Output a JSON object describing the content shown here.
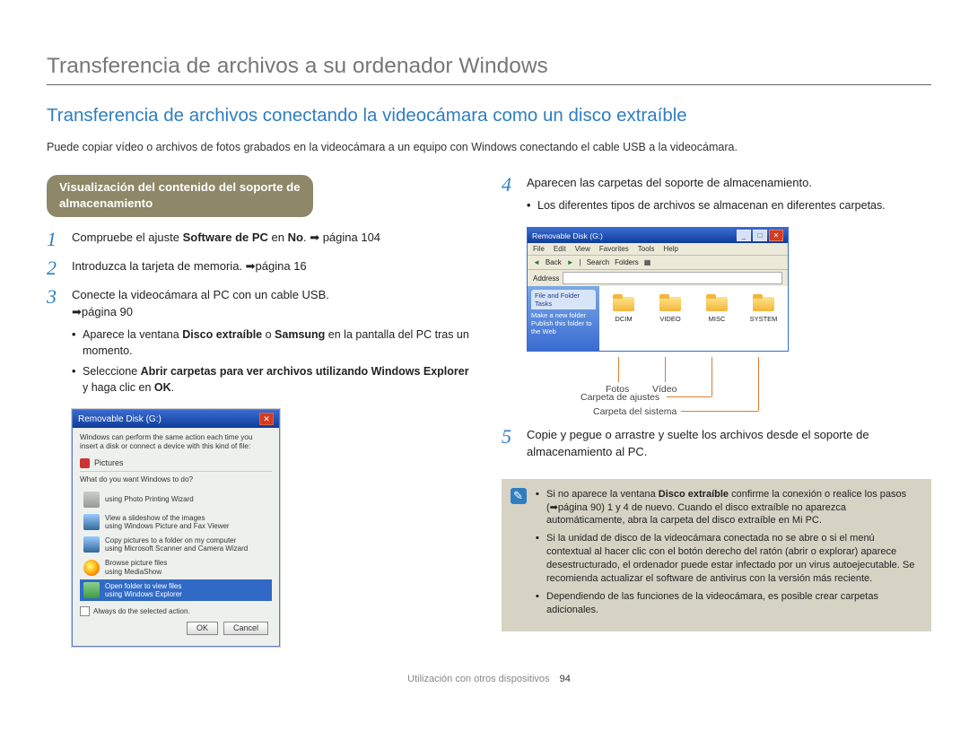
{
  "header": {
    "title": "Transferencia de archivos a su ordenador Windows",
    "section_title": "Transferencia de archivos conectando la videocámara como un disco extraíble",
    "intro": "Puede copiar vídeo o archivos de fotos grabados en la videocámara a un equipo con Windows conectando el cable USB a la videocámara."
  },
  "pill": {
    "line1": "Visualización del contenido del soporte de",
    "line2": "almacenamiento"
  },
  "steps": {
    "s1": {
      "num": "1",
      "text_pre": "Compruebe el ajuste ",
      "bold1": "Software de PC",
      "text_mid": " en ",
      "bold2": "No",
      "text_post": ". ➡ página 104"
    },
    "s2": {
      "num": "2",
      "text": "Introduzca la tarjeta de memoria. ➡página 16"
    },
    "s3": {
      "num": "3",
      "text": "Conecte la videocámara al PC con un cable USB.",
      "cont": "➡página 90",
      "b1_pre": "Aparece la ventana ",
      "b1_bold1": "Disco extraíble",
      "b1_mid": " o ",
      "b1_bold2": "Samsung",
      "b1_post": " en la pantalla del PC tras un momento.",
      "b2_pre": "Seleccione ",
      "b2_bold": "Abrir carpetas para ver archivos utilizando Windows Explorer",
      "b2_post": " y haga clic en ",
      "b2_bold2": "OK",
      "b2_end": "."
    },
    "s4": {
      "num": "4",
      "text": "Aparecen las carpetas del soporte de almacenamiento.",
      "bullet": "Los diferentes tipos de archivos se almacenan en diferentes carpetas."
    },
    "s5": {
      "num": "5",
      "text": "Copie y pegue o arrastre y suelte los archivos desde el soporte de almacenamiento al PC."
    }
  },
  "autoplay": {
    "title": "Removable Disk (G:)",
    "body_text": "Windows can perform the same action each time you insert a disk or connect a device with this kind of file:",
    "pictures": "Pictures",
    "prompt": "What do you want Windows to do?",
    "opts": {
      "o1a": "using Photo Printing Wizard",
      "o2a": "View a slideshow of the images",
      "o2b": "using Windows Picture and Fax Viewer",
      "o3a": "Copy pictures to a folder on my computer",
      "o3b": "using Microsoft Scanner and Camera Wizard",
      "o4a": "Browse picture files",
      "o4b": "using MediaShow",
      "o5a": "Open folder to view files",
      "o5b": "using Windows Explorer"
    },
    "check": "Always do the selected action.",
    "ok": "OK",
    "cancel": "Cancel"
  },
  "explorer": {
    "title": "Removable Disk (G:)",
    "menu": {
      "file": "File",
      "edit": "Edit",
      "view": "View",
      "fav": "Favorites",
      "tools": "Tools",
      "help": "Help"
    },
    "tb": {
      "back": "Back",
      "search": "Search",
      "folders": "Folders"
    },
    "addr": "Address",
    "task": "File and Folder Tasks",
    "side1": "Make a new folder",
    "side2": "Publish this folder to the Web",
    "folders": {
      "f1": "DCIM",
      "f2": "VIDEO",
      "f3": "MISC",
      "f4": "SYSTEM"
    }
  },
  "callouts": {
    "fotos": "Fotos",
    "video": "Vídeo",
    "ajustes": "Carpeta de ajustes",
    "sistema": "Carpeta del sistema"
  },
  "notes": {
    "n1_pre": "Si no aparece la ventana ",
    "n1_bold": "Disco extraíble",
    "n1_post": " confirme la conexión o realice los pasos (➡página 90) 1 y 4 de nuevo. Cuando el disco extraíble no aparezca automáticamente, abra la carpeta del disco extraíble en Mi PC.",
    "n2": "Si la unidad de disco de la videocámara conectada no se abre o si el menú contextual al hacer clic con el botón derecho del ratón (abrir o explorar) aparece desestructurado, el ordenador puede estar infectado por un virus autoejecutable. Se recomienda actualizar el software de antivirus con la versión más reciente.",
    "n3": "Dependiendo de las funciones de la videocámara, es posible crear carpetas adicionales."
  },
  "footer": {
    "section": "Utilización con otros dispositivos",
    "page": "94"
  }
}
